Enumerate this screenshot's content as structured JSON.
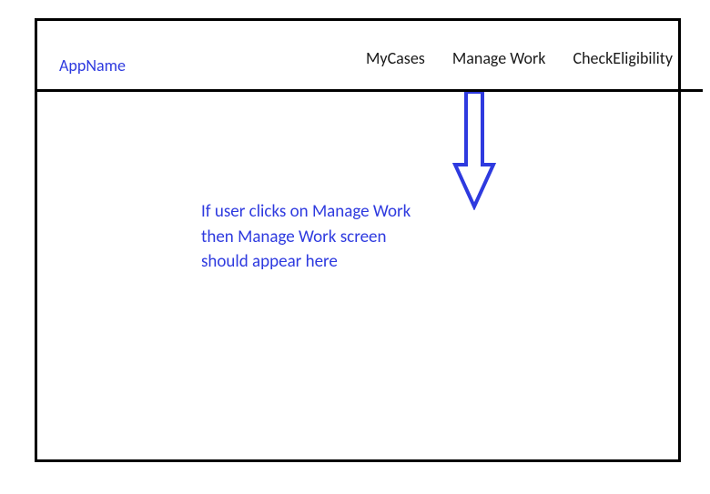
{
  "header": {
    "app_name": "AppName",
    "nav": [
      {
        "label": "MyCases"
      },
      {
        "label": "Manage Work"
      },
      {
        "label": "CheckEligibility"
      }
    ]
  },
  "content": {
    "description": "If user clicks on Manage Work then Manage Work screen should appear here"
  },
  "colors": {
    "accent": "#2e3adf",
    "text": "#1a1a1a",
    "border": "#000000"
  }
}
